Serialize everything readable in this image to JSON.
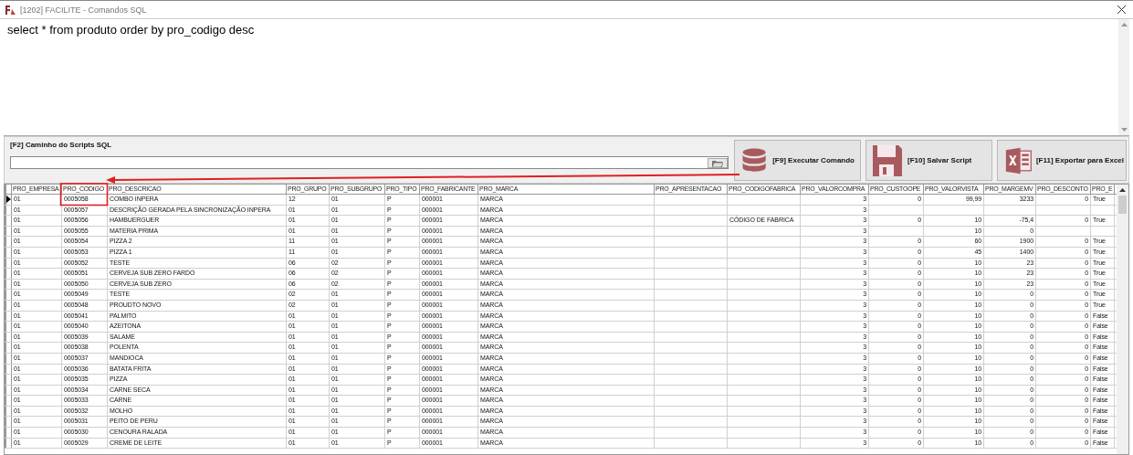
{
  "window": {
    "title": "[1202] FACILITE - Comandos SQL"
  },
  "sql_editor": {
    "value": "select * from produto order by pro_codigo desc"
  },
  "script_path": {
    "label": "[F2] Caminho do Scripts SQL"
  },
  "buttons": [
    {
      "kind": "database",
      "label": "[F9] Executar Comando"
    },
    {
      "kind": "floppy",
      "label": "[F10] Salvar Script"
    },
    {
      "kind": "excel",
      "label": "[F11] Exportar para Excel"
    }
  ],
  "table": {
    "columns": [
      {
        "label": "PRO_EMPRESA",
        "numeric": false
      },
      {
        "label": "PRO_CODIGO",
        "numeric": false
      },
      {
        "label": "PRO_DESCRICAO",
        "numeric": false
      },
      {
        "label": "PRO_GRUPO",
        "numeric": false
      },
      {
        "label": "PRO_SUBGRUPO",
        "numeric": false
      },
      {
        "label": "PRO_TIPO",
        "numeric": false
      },
      {
        "label": "PRO_FABRICANTE",
        "numeric": false
      },
      {
        "label": "PRO_MARCA",
        "numeric": false
      },
      {
        "label": "PRO_APRESENTACAO"
      },
      {
        "label": "PRO_CODIGOFABRICA",
        "numeric": false
      },
      {
        "label": "PRO_VALORCOMPRA",
        "numeric": true
      },
      {
        "label": "PRO_CUSTOOPE",
        "numeric": true
      },
      {
        "label": "PRO_VALORVISTA",
        "numeric": true
      },
      {
        "label": "PRO_MARGEMV",
        "numeric": true
      },
      {
        "label": "PRO_DESCONTO",
        "numeric": true
      },
      {
        "label": "PRO_E",
        "numeric": false
      }
    ],
    "rows": [
      {
        "selected": true,
        "cells": [
          "01",
          "0005058",
          "COMBO INPERA",
          "12",
          "01",
          "P",
          "000001",
          "MARCA",
          "",
          "",
          "3",
          "0",
          "99,99",
          "3233",
          "0",
          "True"
        ]
      },
      {
        "selected": false,
        "cells": [
          "01",
          "0005057",
          "DESCRIÇÃO GERADA PELA SINCRONIZAÇÃO INPERA",
          "01",
          "01",
          "P",
          "000001",
          "MARCA",
          "",
          "",
          "3",
          "",
          "",
          "",
          "",
          ""
        ]
      },
      {
        "selected": false,
        "cells": [
          "01",
          "0005056",
          "HAMBUERGUER",
          "01",
          "01",
          "P",
          "000001",
          "MARCA",
          "",
          "CÓDIGO DE FABRICA",
          "3",
          "0",
          "10",
          "-75,4",
          "0",
          "True"
        ]
      },
      {
        "selected": false,
        "cells": [
          "01",
          "0005055",
          "MATERIA PRIMA",
          "01",
          "01",
          "P",
          "000001",
          "MARCA",
          "",
          "",
          "3",
          "",
          "10",
          "0",
          "",
          ""
        ]
      },
      {
        "selected": false,
        "cells": [
          "01",
          "0005054",
          "PIZZA 2",
          "11",
          "01",
          "P",
          "000001",
          "MARCA",
          "",
          "",
          "3",
          "0",
          "60",
          "1900",
          "0",
          "True"
        ]
      },
      {
        "selected": false,
        "cells": [
          "01",
          "0005053",
          "PIZZA 1",
          "11",
          "01",
          "P",
          "000001",
          "MARCA",
          "",
          "",
          "3",
          "0",
          "45",
          "1400",
          "0",
          "True"
        ]
      },
      {
        "selected": false,
        "cells": [
          "01",
          "0005052",
          "TESTE",
          "06",
          "02",
          "P",
          "000001",
          "MARCA",
          "",
          "",
          "3",
          "0",
          "10",
          "23",
          "0",
          "True"
        ]
      },
      {
        "selected": false,
        "cells": [
          "01",
          "0005051",
          "CERVEJA SUB ZERO FARDO",
          "06",
          "02",
          "P",
          "000001",
          "MARCA",
          "",
          "",
          "3",
          "0",
          "10",
          "23",
          "0",
          "True"
        ]
      },
      {
        "selected": false,
        "cells": [
          "01",
          "0005050",
          "CERVEJA SUB ZERO",
          "06",
          "02",
          "P",
          "000001",
          "MARCA",
          "",
          "",
          "3",
          "0",
          "10",
          "23",
          "0",
          "True"
        ]
      },
      {
        "selected": false,
        "cells": [
          "01",
          "0005049",
          "TESTE",
          "02",
          "01",
          "P",
          "000001",
          "MARCA",
          "",
          "",
          "3",
          "0",
          "10",
          "0",
          "0",
          "True"
        ]
      },
      {
        "selected": false,
        "cells": [
          "01",
          "0005048",
          "PROUDTO NOVO",
          "02",
          "01",
          "P",
          "000001",
          "MARCA",
          "",
          "",
          "3",
          "0",
          "10",
          "0",
          "0",
          "True"
        ]
      },
      {
        "selected": false,
        "cells": [
          "01",
          "0005041",
          "PALMITO",
          "01",
          "01",
          "P",
          "000001",
          "MARCA",
          "",
          "",
          "3",
          "0",
          "10",
          "0",
          "0",
          "False"
        ]
      },
      {
        "selected": false,
        "cells": [
          "01",
          "0005040",
          "AZEITONA",
          "01",
          "01",
          "P",
          "000001",
          "MARCA",
          "",
          "",
          "3",
          "0",
          "10",
          "0",
          "0",
          "False"
        ]
      },
      {
        "selected": false,
        "cells": [
          "01",
          "0005039",
          "SALAME",
          "01",
          "01",
          "P",
          "000001",
          "MARCA",
          "",
          "",
          "3",
          "0",
          "10",
          "0",
          "0",
          "False"
        ]
      },
      {
        "selected": false,
        "cells": [
          "01",
          "0005038",
          "POLENTA",
          "01",
          "01",
          "P",
          "000001",
          "MARCA",
          "",
          "",
          "3",
          "0",
          "10",
          "0",
          "0",
          "False"
        ]
      },
      {
        "selected": false,
        "cells": [
          "01",
          "0005037",
          "MANDIOCA",
          "01",
          "01",
          "P",
          "000001",
          "MARCA",
          "",
          "",
          "3",
          "0",
          "10",
          "0",
          "0",
          "False"
        ]
      },
      {
        "selected": false,
        "cells": [
          "01",
          "0005036",
          "BATATA FRITA",
          "01",
          "01",
          "P",
          "000001",
          "MARCA",
          "",
          "",
          "3",
          "0",
          "10",
          "0",
          "0",
          "False"
        ]
      },
      {
        "selected": false,
        "cells": [
          "01",
          "0005035",
          "PIZZA",
          "01",
          "01",
          "P",
          "000001",
          "MARCA",
          "",
          "",
          "3",
          "0",
          "10",
          "0",
          "0",
          "False"
        ]
      },
      {
        "selected": false,
        "cells": [
          "01",
          "0005034",
          "CARNE SECA",
          "01",
          "01",
          "P",
          "000001",
          "MARCA",
          "",
          "",
          "3",
          "0",
          "10",
          "0",
          "0",
          "False"
        ]
      },
      {
        "selected": false,
        "cells": [
          "01",
          "0005033",
          "CARNE",
          "01",
          "01",
          "P",
          "000001",
          "MARCA",
          "",
          "",
          "3",
          "0",
          "10",
          "0",
          "0",
          "False"
        ]
      },
      {
        "selected": false,
        "cells": [
          "01",
          "0005032",
          "MOLHO",
          "01",
          "01",
          "P",
          "000001",
          "MARCA",
          "",
          "",
          "3",
          "0",
          "10",
          "0",
          "0",
          "False"
        ]
      },
      {
        "selected": false,
        "cells": [
          "01",
          "0005031",
          "PEITO DE PERU",
          "01",
          "01",
          "P",
          "000001",
          "MARCA",
          "",
          "",
          "3",
          "0",
          "10",
          "0",
          "0",
          "False"
        ]
      },
      {
        "selected": false,
        "cells": [
          "01",
          "0005030",
          "CENOURA RALADA",
          "01",
          "01",
          "P",
          "000001",
          "MARCA",
          "",
          "",
          "3",
          "0",
          "10",
          "0",
          "0",
          "False"
        ]
      },
      {
        "selected": false,
        "cells": [
          "01",
          "0005029",
          "CREME DE LEITE",
          "01",
          "01",
          "P",
          "000001",
          "MARCA",
          "",
          "",
          "3",
          "0",
          "10",
          "0",
          "0",
          "False"
        ]
      }
    ]
  }
}
